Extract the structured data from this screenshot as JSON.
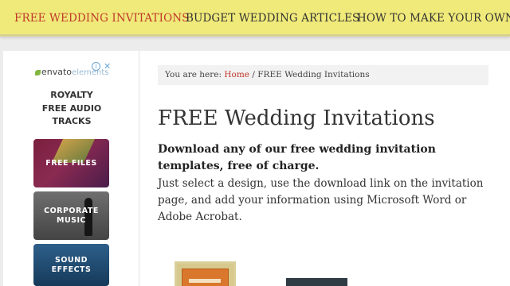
{
  "nav": {
    "items": [
      {
        "label": "FREE WEDDING INVITATIONS"
      },
      {
        "label": "BUDGET WEDDING ARTICLES"
      },
      {
        "label": "HOW TO MAKE YOUR OWN W"
      }
    ],
    "active_color": "#c0392b",
    "bar_color": "#f0ea7a"
  },
  "sidebar_ad": {
    "logo_text": "envato",
    "logo_suffix": "elements",
    "info_glyph": "i",
    "close_glyph": "✕",
    "heading_lines": [
      "ROYALTY",
      "FREE AUDIO",
      "TRACKS"
    ],
    "tiles": [
      {
        "label": "FREE FILES"
      },
      {
        "label": "CORPORATE MUSIC"
      },
      {
        "label": "SOUND EFFECTS"
      }
    ]
  },
  "breadcrumb": {
    "prefix": "You are here:",
    "home": "Home",
    "separator": "/",
    "current": "FREE Wedding Invitations"
  },
  "content": {
    "title": "FREE Wedding Invitations",
    "lead": "Download any of our free wedding invitation templates, free of charge.",
    "body": "Just select a design, use the download link on the invitation page, and add your information using Microsoft Word or Adobe Acrobat."
  }
}
